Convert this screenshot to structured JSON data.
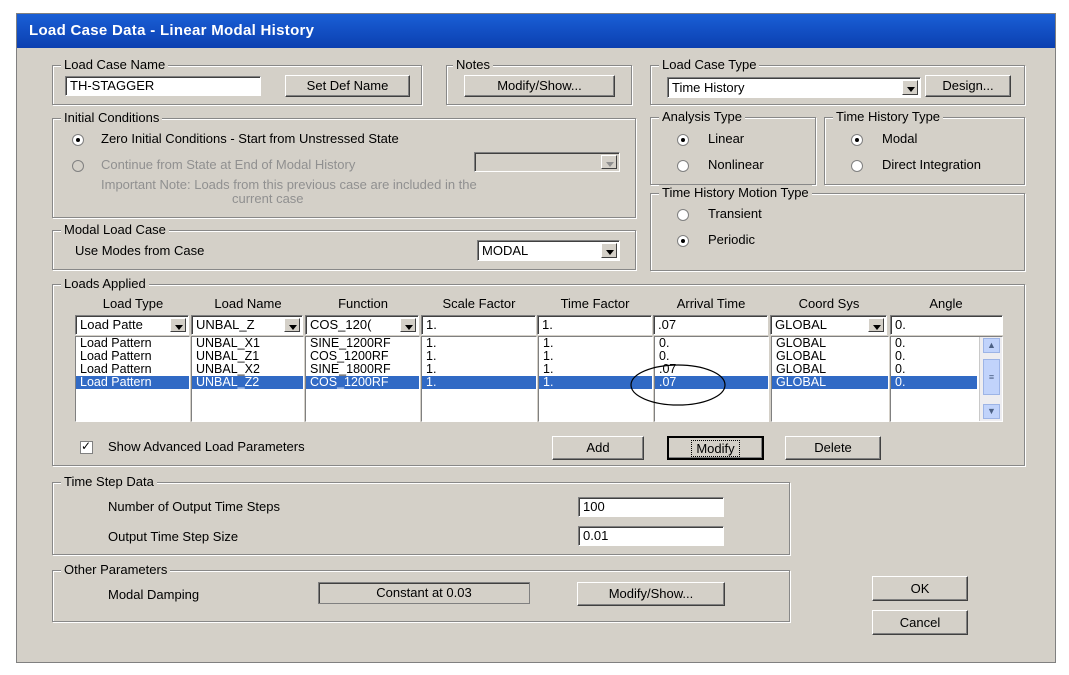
{
  "window": {
    "title": "Load Case Data - Linear Modal History"
  },
  "load_case_name": {
    "legend": "Load Case Name",
    "value": "TH-STAGGER",
    "set_def_name": "Set Def Name"
  },
  "notes": {
    "legend": "Notes",
    "modify_show": "Modify/Show..."
  },
  "load_case_type": {
    "legend": "Load Case Type",
    "value": "Time History",
    "design": "Design..."
  },
  "initial_conditions": {
    "legend": "Initial Conditions",
    "option_zero": "Zero Initial Conditions - Start from Unstressed State",
    "option_continue": "Continue from State at End of Modal History",
    "note_line1": "Important Note:  Loads from this previous case are included in the",
    "note_line2": "current case"
  },
  "analysis_type": {
    "legend": "Analysis Type",
    "linear": "Linear",
    "nonlinear": "Nonlinear"
  },
  "time_history_type": {
    "legend": "Time History Type",
    "modal": "Modal",
    "direct": "Direct Integration"
  },
  "motion_type": {
    "legend": "Time History Motion Type",
    "transient": "Transient",
    "periodic": "Periodic"
  },
  "modal_load_case": {
    "legend": "Modal Load Case",
    "label": "Use Modes from Case",
    "value": "MODAL"
  },
  "loads_applied": {
    "legend": "Loads Applied",
    "headers": [
      "Load Type",
      "Load Name",
      "Function",
      "Scale Factor",
      "Time Factor",
      "Arrival Time",
      "Coord Sys",
      "Angle"
    ],
    "edit_row": [
      "Load Patte",
      "UNBAL_Z",
      "COS_120(",
      "1.",
      "1.",
      ".07",
      "GLOBAL",
      "0."
    ],
    "rows": [
      [
        "Load Pattern",
        "UNBAL_X1",
        "SINE_1200RF",
        "1.",
        "1.",
        "0.",
        "GLOBAL",
        "0."
      ],
      [
        "Load Pattern",
        "UNBAL_Z1",
        "COS_1200RF",
        "1.",
        "1.",
        "0.",
        "GLOBAL",
        "0."
      ],
      [
        "Load Pattern",
        "UNBAL_X2",
        "SINE_1800RF",
        "1.",
        "1.",
        ".07",
        "GLOBAL",
        "0."
      ],
      [
        "Load Pattern",
        "UNBAL_Z2",
        "COS_1200RF",
        "1.",
        "1.",
        ".07",
        "GLOBAL",
        "0."
      ]
    ],
    "selected_row": 3,
    "show_advanced": "Show Advanced Load Parameters",
    "add": "Add",
    "modify": "Modify",
    "delete": "Delete"
  },
  "time_step": {
    "legend": "Time Step Data",
    "num_label": "Number of Output Time Steps",
    "num_value": "100",
    "size_label": "Output Time Step Size",
    "size_value": "0.01"
  },
  "other": {
    "legend": "Other Parameters",
    "damping_label": "Modal Damping",
    "damping_value": "Constant at 0.03",
    "modify_show": "Modify/Show..."
  },
  "dialog": {
    "ok": "OK",
    "cancel": "Cancel"
  },
  "colors": {
    "title_bar": "#0b3fb0",
    "selection": "#316ac5",
    "dialog_bg": "#d4d0c8"
  }
}
